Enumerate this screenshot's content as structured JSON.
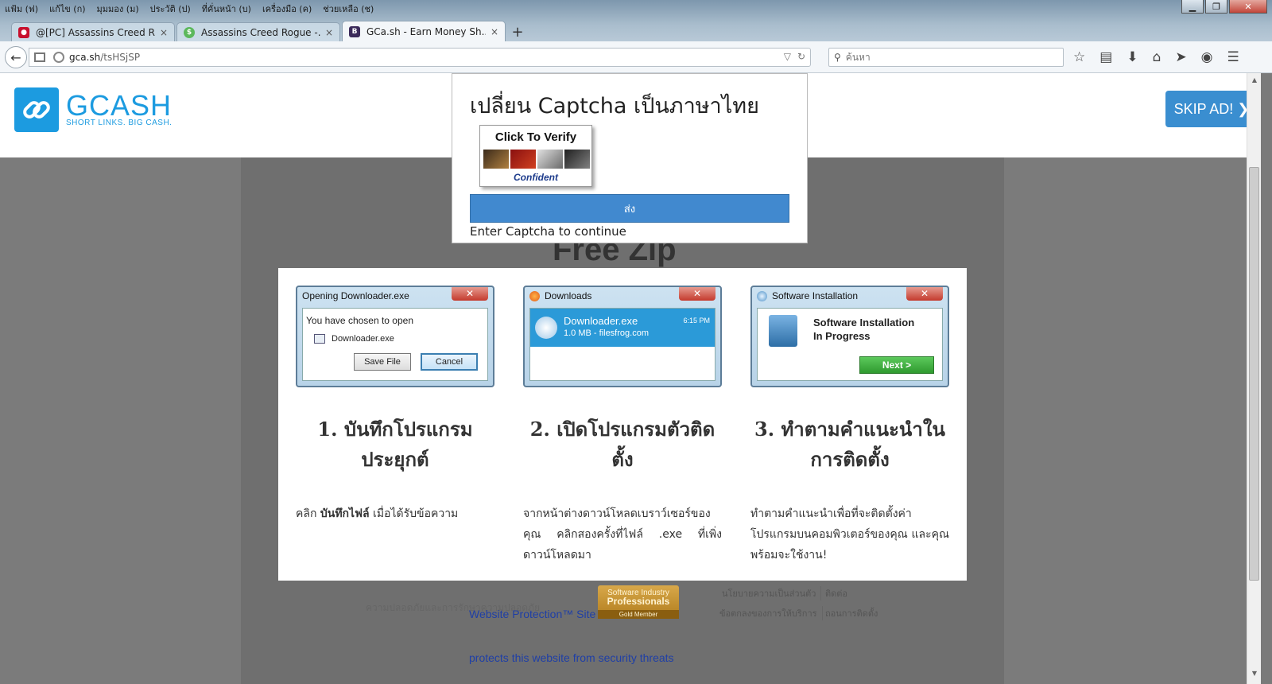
{
  "menu": [
    "แฟ้ม (ฟ)",
    "แก้ไข (ก)",
    "มุมมอง (ม)",
    "ประวัติ (ป)",
    "ที่คั่นหน้า (บ)",
    "เครื่องมือ (ค)",
    "ช่วยเหลือ (ช)"
  ],
  "tabs": [
    {
      "title": "@[PC] Assassins Creed R...",
      "close": "×"
    },
    {
      "title": "Assassins Creed Rogue -...",
      "close": "×"
    },
    {
      "title": "GCa.sh - Earn Money Sh...",
      "close": "×"
    }
  ],
  "url": {
    "host": "gca.sh",
    "path": "/tsHSjSP"
  },
  "search": {
    "placeholder": "ค้นหา"
  },
  "header": {
    "logo": "GCASH",
    "tagline": "SHORT LINKS. BIG CASH.",
    "skip": "SKIP AD! ❯"
  },
  "modal": {
    "title": "เปลี่ยน Captcha เป็นภาษาไทย",
    "captcha_label": "Click To Verify",
    "captcha_brand": "Confident",
    "submit": "ส่ง",
    "hint": "Enter Captcha to continue"
  },
  "page": {
    "heading": "Free Zip",
    "steps": [
      {
        "window_title": "Opening Downloader.exe",
        "line1": "You have chosen to open",
        "file": "Downloader.exe",
        "btn1": "Save File",
        "btn2": "Cancel",
        "title": "1. บันทึกโปรแกรมประยุกต์",
        "desc_bold": "บันทึกไฟล์",
        "desc_pre": "คลิก",
        "desc_post": "เมื่อได้รับข้อความ"
      },
      {
        "window_title": "Downloads",
        "file": "Downloader.exe",
        "meta": "1.0 MB - filesfrog.com",
        "time": "6:15 PM",
        "title": "2. เปิดโปรแกรมตัวติดตั้ง",
        "desc": "จากหน้าต่างดาวน์โหลดเบราว์เซอร์ของคุณ คลิกสองครั้งที่ไฟล์ .exe ที่เพิ่งดาวน์โหลดมา"
      },
      {
        "window_title": "Software Installation",
        "line1": "Software Installation",
        "line2": "In Progress",
        "btn": "Next >",
        "title": "3. ทำตามคำแนะนำในการติดตั้ง",
        "desc": "ทำตามคำแนะนำเพื่อที่จะติดตั้งค่าโปรแกรมบนคอมพิวเตอร์ของคุณ และคุณพร้อมจะใช้งาน!"
      }
    ],
    "footer": {
      "security": "ความปลอดภัยและการรักษาความปลอดภัย",
      "protection": "Website Protection™ Site",
      "protects": "protects this website from security threats",
      "badge_l1": "Software Industry",
      "badge_l2": "Professionals",
      "badge_l3": "Gold Member",
      "privacy": "นโยบายความเป็นส่วนตัว",
      "contact": "ติดต่อ",
      "terms": "ข้อตกลงของการให้บริการ",
      "uninstall": "ถอนการติดตั้ง"
    }
  },
  "colors": {
    "brand": "#1c9be0",
    "submit": "#4189cf",
    "skip": "#3a8ed0"
  }
}
